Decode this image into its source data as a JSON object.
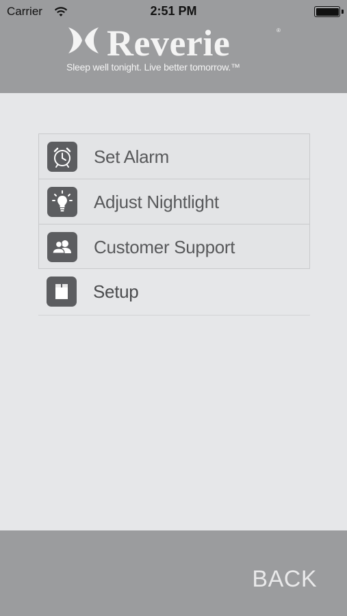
{
  "status_bar": {
    "carrier": "Carrier",
    "time": "2:51 PM",
    "wifi_icon": "wifi-icon",
    "battery_icon": "battery-icon"
  },
  "header": {
    "brand": "Reverie",
    "registered_mark": "®",
    "tagline": "Sleep well tonight. Live better tomorrow.™",
    "logo_icon": "reverie-logo-icon"
  },
  "menu": {
    "items": [
      {
        "label": "Set Alarm",
        "icon": "alarm-clock-icon"
      },
      {
        "label": "Adjust Nightlight",
        "icon": "lightbulb-icon"
      },
      {
        "label": "Customer Support",
        "icon": "people-icon"
      },
      {
        "label": "Setup",
        "icon": "box-icon"
      }
    ]
  },
  "footer": {
    "back_label": "BACK"
  },
  "colors": {
    "header_bg": "#9b9c9e",
    "body_bg": "#e6e7e9",
    "icon_bg": "#5c5d60",
    "label_text": "#58595b"
  }
}
